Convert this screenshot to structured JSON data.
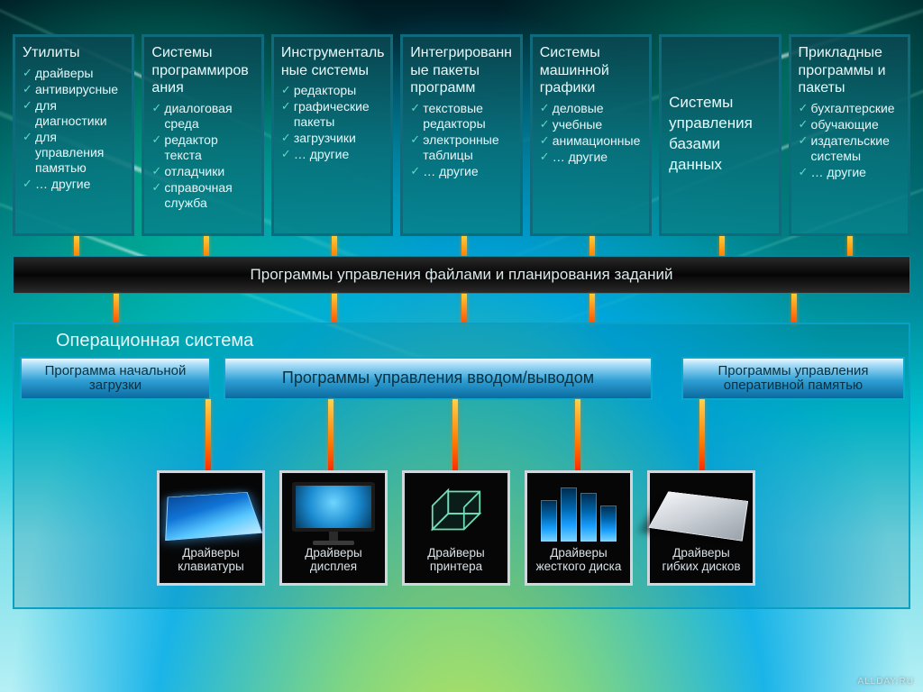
{
  "categories": [
    {
      "title": "Утилиты",
      "items": [
        "драйверы",
        "антивирусные",
        "для диагностики",
        "для управления памятью",
        "… другие"
      ]
    },
    {
      "title": "Системы программирования",
      "items": [
        "диалоговая среда",
        "редактор текста",
        "отладчики",
        "справочная служба"
      ]
    },
    {
      "title": "Инструментальные системы",
      "items": [
        "редакторы",
        "графические пакеты",
        "загрузчики",
        "… другие"
      ]
    },
    {
      "title": "Интегрированные пакеты программ",
      "items": [
        "текстовые редакторы",
        "электронные таблицы",
        "… другие"
      ]
    },
    {
      "title": "Системы машинной графики",
      "items": [
        "деловые",
        "учебные",
        "анимационные",
        "… другие"
      ]
    },
    {
      "title": "Системы управления базами данных",
      "items": []
    },
    {
      "title": "Прикладные программы и пакеты",
      "items": [
        "бухгалтерские",
        "обучающие",
        "издательские системы",
        "… другие"
      ]
    }
  ],
  "middle_bar": "Программы управления файлами и планирования заданий",
  "os": {
    "title": "Операционная система",
    "boot": "Программа начальной загрузки",
    "io": "Программы управления вводом/выводом",
    "mem": "Программы управления оперативной памятью"
  },
  "drivers": [
    {
      "label": "Драйверы клавиатуры",
      "icon": "keyboard-icon"
    },
    {
      "label": "Драйверы дисплея",
      "icon": "monitor-icon"
    },
    {
      "label": "Драйверы принтера",
      "icon": "printer-icon"
    },
    {
      "label": "Драйверы жесткого диска",
      "icon": "hdd-icon"
    },
    {
      "label": "Драйверы гибких дисков",
      "icon": "floppy-icon"
    }
  ],
  "watermark": "ALLDAY.RU"
}
